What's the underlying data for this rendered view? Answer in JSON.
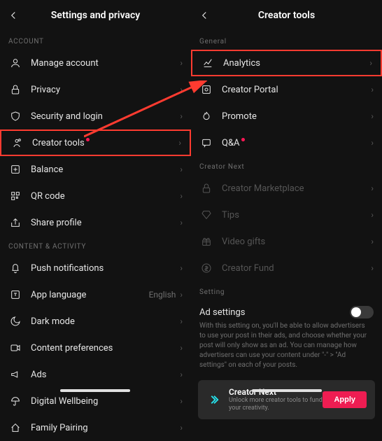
{
  "left": {
    "title": "Settings and privacy",
    "section_account": "ACCOUNT",
    "items_account": [
      "Manage account",
      "Privacy",
      "Security and login",
      "Creator tools",
      "Balance",
      "QR code",
      "Share profile"
    ],
    "section_content": "CONTENT & ACTIVITY",
    "items_content": [
      "Push notifications",
      "App language",
      "Dark mode",
      "Content preferences",
      "Ads",
      "Digital Wellbeing",
      "Family Pairing"
    ],
    "app_language_value": "English"
  },
  "right": {
    "title": "Creator tools",
    "section_general": "General",
    "items_general": [
      "Analytics",
      "Creator Portal",
      "Promote",
      "Q&A"
    ],
    "section_creator_next": "Creator Next",
    "items_creator_next": [
      "Creator Marketplace",
      "Tips",
      "Video gifts",
      "Creator Fund"
    ],
    "section_setting": "Setting",
    "ad_settings_title": "Ad settings",
    "ad_settings_desc": "With this setting on, you'll be able to allow advertisers to use your post in their ads, and choose whether your post will only show as an ad. You can manage how advertisers can use your content under \"-\" > \"Ad settings\" on each of your posts.",
    "card_title": "Creator Next",
    "card_sub": "Unlock more creator tools to fund your creativity.",
    "apply": "Apply"
  },
  "colors": {
    "accent": "#ee1d52",
    "highlight": "#ff3b30"
  }
}
